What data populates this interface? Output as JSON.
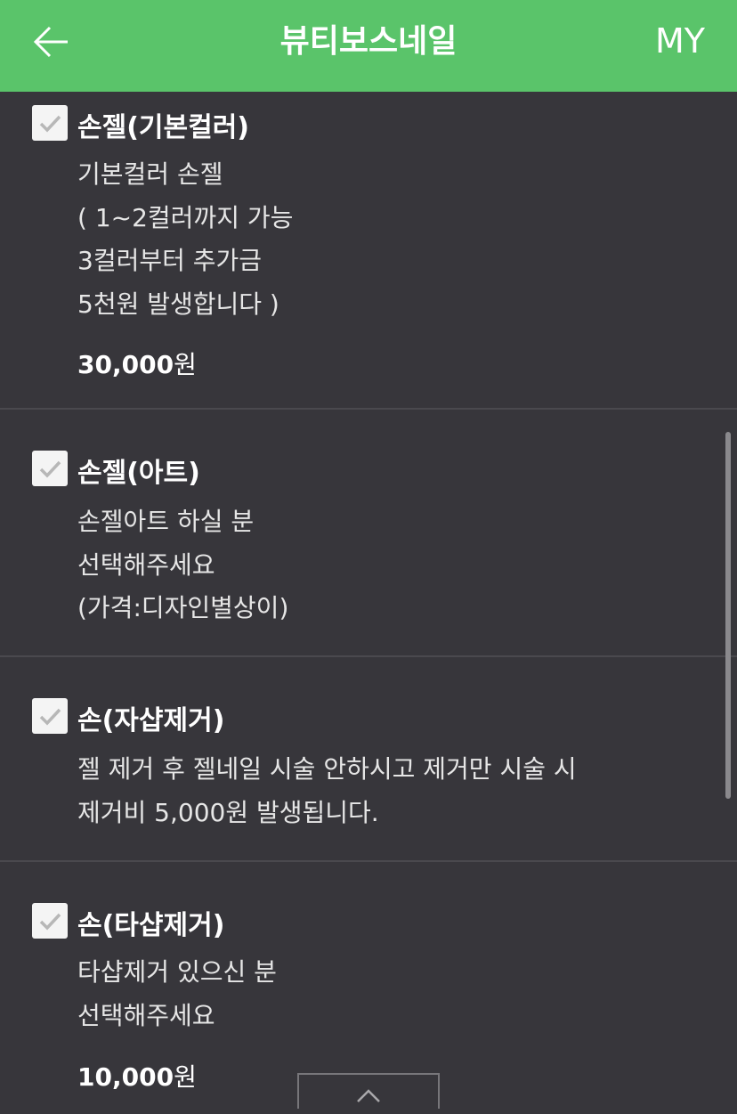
{
  "header": {
    "title": "뷰티보스네일",
    "my_label": "MY",
    "color": "#5ac46a"
  },
  "items": [
    {
      "title": "손젤(기본컬러)",
      "description": [
        "기본컬러 손젤",
        "( 1~2컬러까지 가능",
        "3컬러부터 추가금",
        "5천원 발생합니다 )"
      ],
      "price": "30,000",
      "price_unit": "원",
      "checked": true
    },
    {
      "title": "손젤(아트)",
      "description": [
        "손젤아트 하실 분",
        "선택해주세요",
        "(가격:디자인별상이)"
      ],
      "checked": true
    },
    {
      "title": "손(자샵제거)",
      "description": [
        "젤 제거 후 젤네일 시술 안하시고 제거만 시술 시",
        "제거비 5,000원 발생됩니다."
      ],
      "checked": true
    },
    {
      "title": "손(타샵제거)",
      "description": [
        "타샵제거 있으신 분",
        "선택해주세요"
      ],
      "price": "10,000",
      "price_unit": "원",
      "checked": true
    }
  ],
  "icons": {
    "back": "arrow-left-icon",
    "check": "checkmark-icon",
    "up": "chevron-up-icon"
  }
}
